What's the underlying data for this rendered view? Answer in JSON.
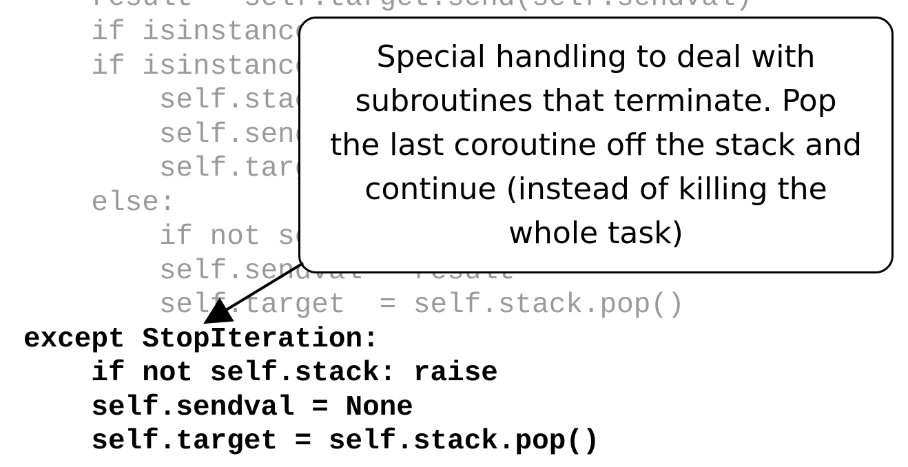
{
  "code_lines": [
    "    result = self.target.send(self.sendval)",
    "    if isinstance(result,SystemCall): return result",
    "    if isinstance(result,types.GeneratorType):",
    "        self.stack.append(self.target)",
    "        self.sendval = None",
    "        self.target  = result",
    "    else:",
    "        if not self.stack: return result",
    "        self.sendval = result",
    "        self.target  = self.stack.pop()",
    "except StopIteration:",
    "    if not self.stack: raise",
    "    self.sendval = None",
    "    self.target = self.stack.pop()"
  ],
  "callout": {
    "text": "Special handling to deal with\nsubroutines that terminate.  Pop\nthe last coroutine off the stack and\ncontinue (instead of killing the\nwhole task)"
  },
  "colors": {
    "dimmed_code": "#9a9a9a",
    "highlighted_code": "#000000",
    "callout_border": "#000000",
    "arrow": "#000000"
  }
}
